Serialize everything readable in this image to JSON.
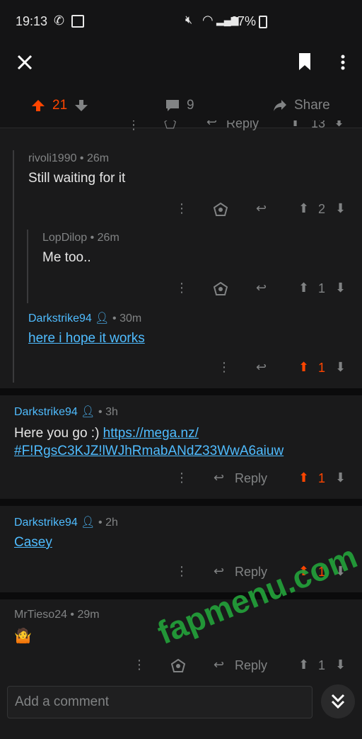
{
  "status_bar": {
    "time": "19:13",
    "battery": "67%"
  },
  "post_actions": {
    "upvotes": "21",
    "comments": "9",
    "share": "Share"
  },
  "cutoff_row": {
    "reply": "Reply",
    "score": "13"
  },
  "comments": [
    {
      "author": "rivoli1990",
      "age": "26m",
      "text": "Still waiting for it",
      "score": "2"
    },
    {
      "author": "LopDilop",
      "age": "26m",
      "text": "Me too..",
      "score": "1"
    },
    {
      "author": "Darkstrike94",
      "age": "30m",
      "text": "here i hope it works",
      "score": "1"
    },
    {
      "author": "Darkstrike94",
      "age": "3h",
      "text_prefix": "Here you go :) ",
      "link": "https://mega.nz/#F!RgsC3KJZ!lWJhRmabANdZ33WwA6aiuw",
      "link_line1": "https://mega.nz/",
      "link_line2": "#F!RgsC3KJZ!lWJhRmabANdZ33WwA6aiuw",
      "reply": "Reply",
      "score": "1"
    },
    {
      "author": "Darkstrike94",
      "age": "2h",
      "link": "Casey",
      "reply": "Reply",
      "score": "1"
    },
    {
      "author": "MrTieso24",
      "age": "29m",
      "emoji": "🤷",
      "reply": "Reply",
      "score": "1"
    }
  ],
  "composer": {
    "placeholder": "Add a comment"
  },
  "watermark": "fapmenu.com",
  "colors": {
    "accent_orange": "#ff4500",
    "link_blue": "#4fbcff",
    "bg": "#1a1a1b"
  }
}
